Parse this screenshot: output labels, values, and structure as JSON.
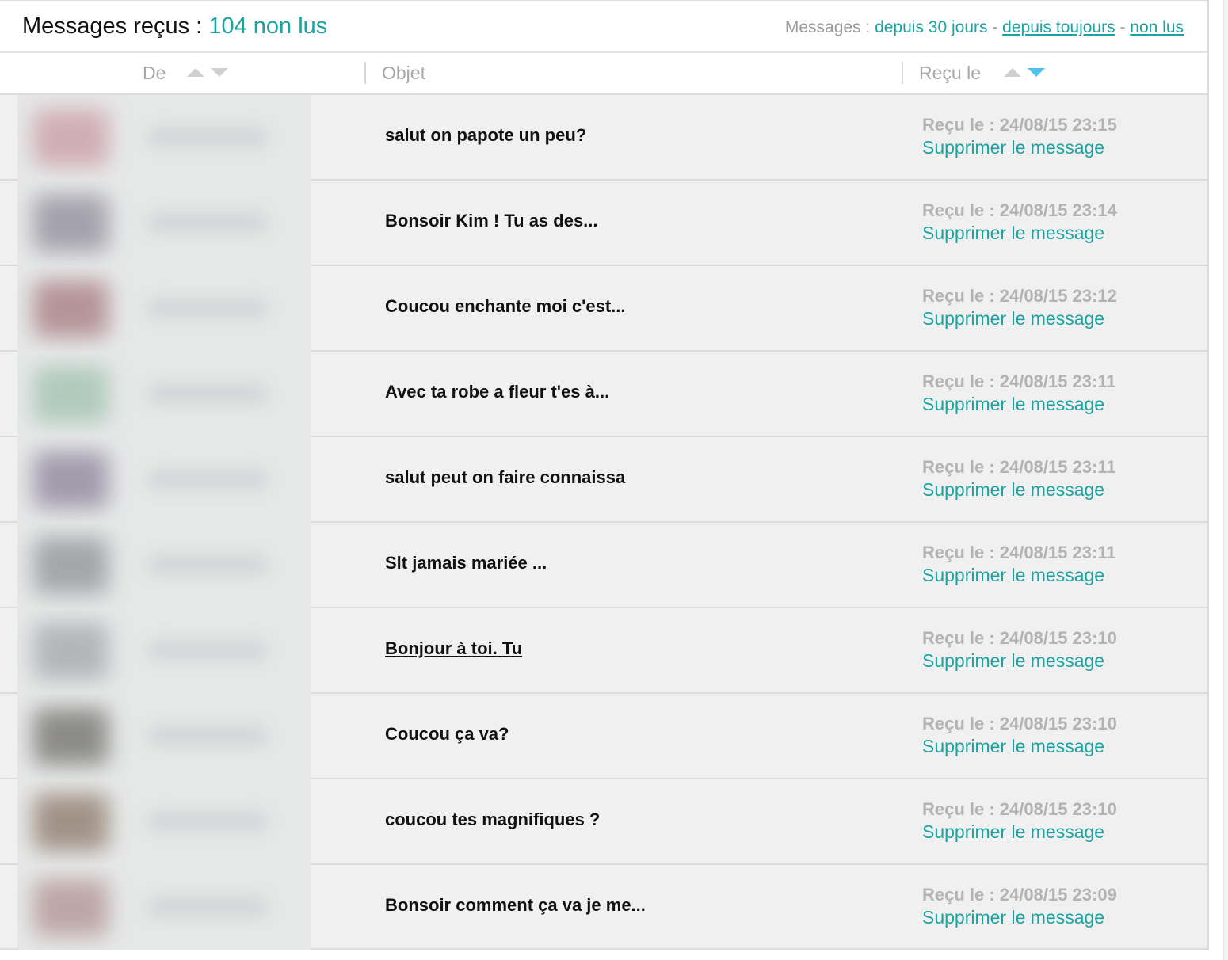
{
  "header": {
    "title_prefix": "Messages reçus : ",
    "unread_count": "104 non lus",
    "filter_label": "Messages : ",
    "filters": [
      {
        "label": "depuis 30 jours",
        "underlined": false
      },
      {
        "label": "depuis toujours",
        "underlined": true
      },
      {
        "label": "non lus",
        "underlined": true
      }
    ],
    "filter_separator": " - "
  },
  "columns": {
    "from": "De",
    "subject": "Objet",
    "received": "Reçu le"
  },
  "sort": {
    "column": "received",
    "direction": "desc"
  },
  "colors": {
    "accent": "#1aa3a0",
    "sort_active": "#4fc3ee"
  },
  "messages": [
    {
      "subject": "salut on papote un peu?",
      "received": "Reçu le : 24/08/15 23:15",
      "delete_label": "Supprimer le message",
      "avatar_color": "#c99aa3"
    },
    {
      "subject": "Bonsoir Kim ! Tu as des...",
      "received": "Reçu le : 24/08/15 23:14",
      "delete_label": "Supprimer le message",
      "avatar_color": "#8e8a98"
    },
    {
      "subject": "Coucou enchante moi c'est...",
      "received": "Reçu le : 24/08/15 23:12",
      "delete_label": "Supprimer le message",
      "avatar_color": "#a5787e"
    },
    {
      "subject": "Avec ta robe a fleur t'es à...",
      "received": "Reçu le : 24/08/15 23:11",
      "delete_label": "Supprimer le message",
      "avatar_color": "#9fc0ae"
    },
    {
      "subject": "salut peut on faire connaissa",
      "received": "Reçu le : 24/08/15 23:11",
      "delete_label": "Supprimer le message",
      "avatar_color": "#8b8299"
    },
    {
      "subject": "Slt jamais mariée ...",
      "received": "Reçu le : 24/08/15 23:11",
      "delete_label": "Supprimer le message",
      "avatar_color": "#8e9094"
    },
    {
      "subject": "Bonjour à toi. Tu",
      "received": "Reçu le : 24/08/15 23:10",
      "delete_label": "Supprimer le message",
      "avatar_color": "#a2a6a8",
      "hovered": true
    },
    {
      "subject": "Coucou ça va?",
      "received": "Reçu le : 24/08/15 23:10",
      "delete_label": "Supprimer le message",
      "avatar_color": "#6f6d68"
    },
    {
      "subject": "coucou tes magnifiques ?",
      "received": "Reçu le : 24/08/15 23:10",
      "delete_label": "Supprimer le message",
      "avatar_color": "#8b7666"
    },
    {
      "subject": "Bonsoir comment ça va je me...",
      "received": "Reçu le : 24/08/15 23:09",
      "delete_label": "Supprimer le message",
      "avatar_color": "#b09090"
    }
  ]
}
